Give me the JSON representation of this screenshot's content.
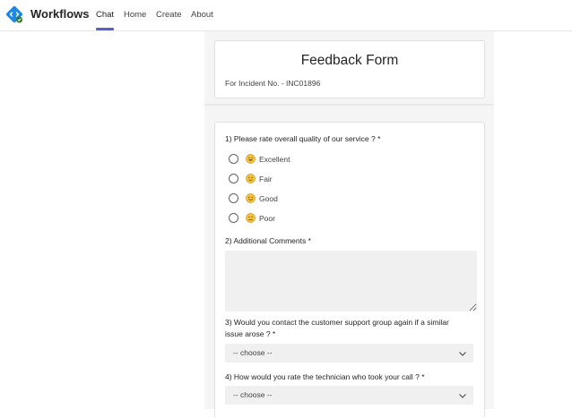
{
  "app": {
    "title": "Workflows",
    "accent": "#5b5fc7",
    "logo_color": "#1e88e5",
    "tabs": [
      {
        "label": "Chat",
        "active": true
      },
      {
        "label": "Home",
        "active": false
      },
      {
        "label": "Create",
        "active": false
      },
      {
        "label": "About",
        "active": false
      }
    ]
  },
  "form": {
    "title": "Feedback Form",
    "incident": "For Incident No. - INC01896",
    "q1": {
      "label": "1)  Please rate overall quality of our service ? *",
      "options": [
        {
          "label": "Excellent",
          "icon": "grinning-face-icon"
        },
        {
          "label": "Fair",
          "icon": "slight-smile-face-icon"
        },
        {
          "label": "Good",
          "icon": "smile-face-icon"
        },
        {
          "label": "Poor",
          "icon": "frowning-face-icon"
        }
      ]
    },
    "q2": {
      "label": "2)  Additional Comments *",
      "value": ""
    },
    "q3": {
      "label": "3)  Would you contact the customer support group again if a similar issue arose ? *",
      "selected": "-- choose --"
    },
    "q4": {
      "label": "4)  How would you rate the technician who took your call ? *",
      "selected": "-- choose --"
    }
  }
}
